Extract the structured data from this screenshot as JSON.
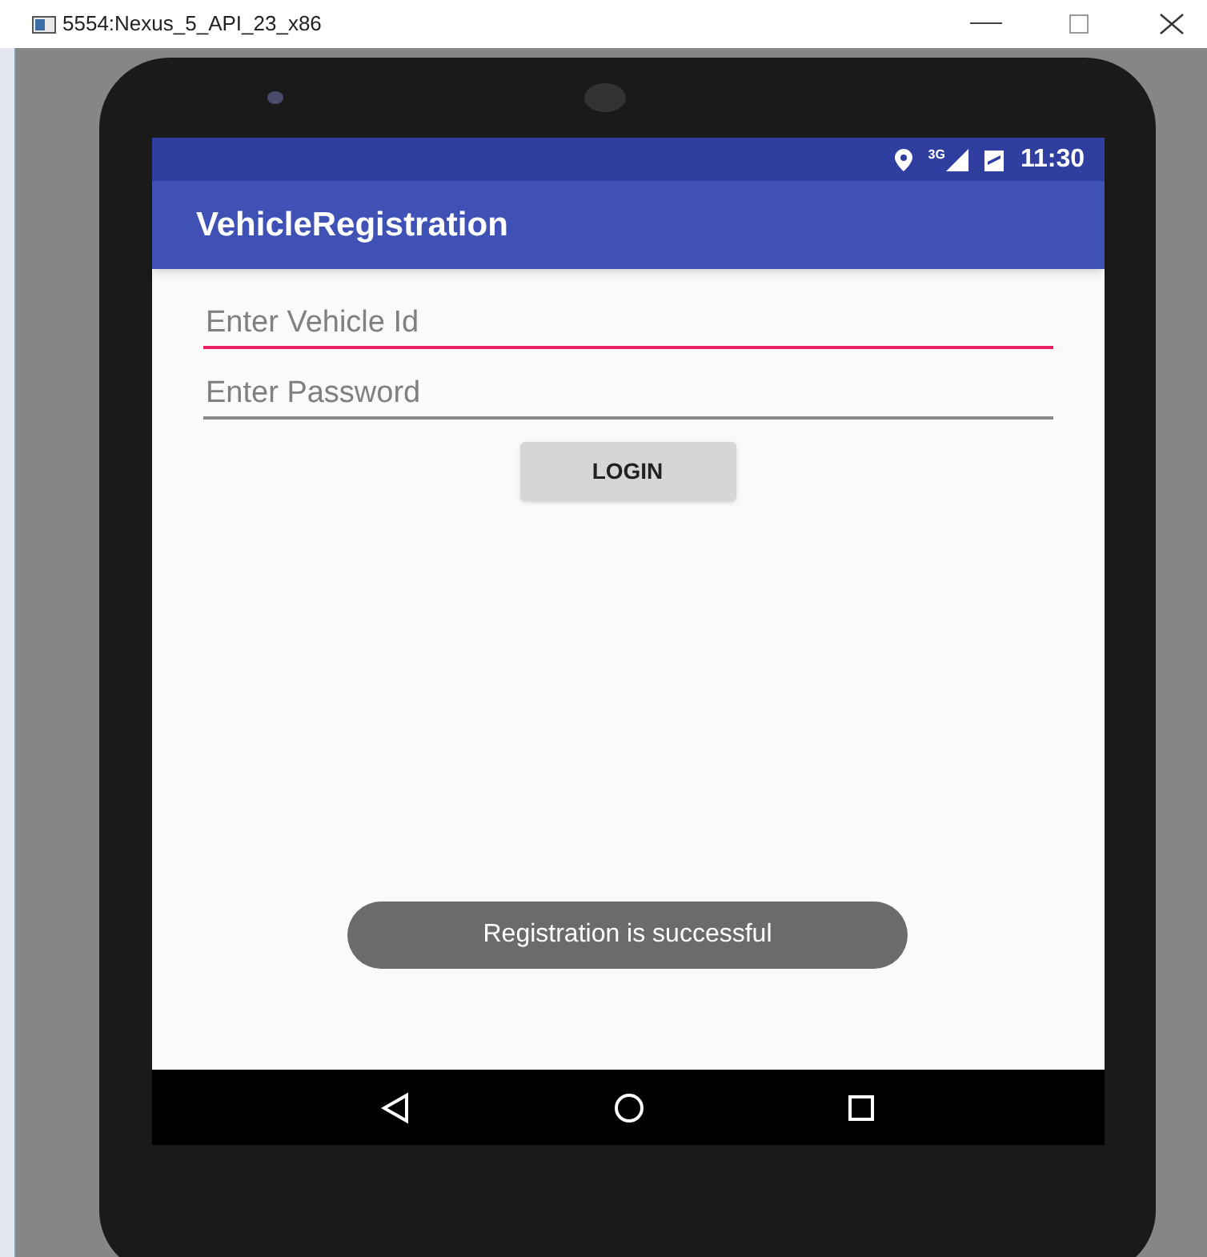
{
  "window": {
    "title": "5554:Nexus_5_API_23_x86"
  },
  "status_bar": {
    "network": "3G",
    "time": "11:30"
  },
  "app_bar": {
    "title": "VehicleRegistration"
  },
  "fields": [
    {
      "placeholder": "Enter Vehicle Id",
      "focused": true
    },
    {
      "placeholder": "Enter Password",
      "focused": false
    }
  ],
  "login_button": {
    "label": "LOGIN"
  },
  "toast": {
    "text": "Registration is successful"
  }
}
